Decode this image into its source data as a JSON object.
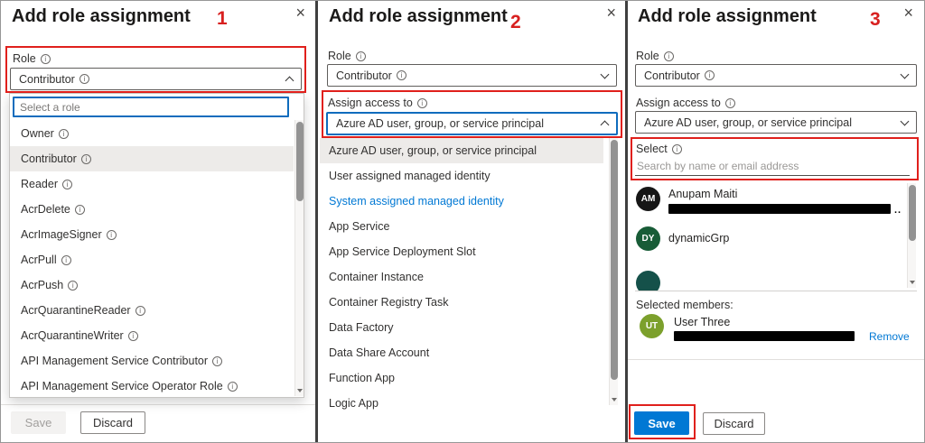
{
  "icons": {
    "close": "×",
    "info": "i"
  },
  "colors": {
    "accent": "#0078d4",
    "annotation_red": "#e0201c",
    "row_highlight": "#edebe9"
  },
  "panels": [
    {
      "title": "Add role assignment",
      "annotation": "1",
      "role": {
        "label": "Role",
        "value": "Contributor"
      },
      "role_picker": {
        "search_placeholder": "Select a role",
        "items": [
          "Owner",
          "Contributor",
          "Reader",
          "AcrDelete",
          "AcrImageSigner",
          "AcrPull",
          "AcrPush",
          "AcrQuarantineReader",
          "AcrQuarantineWriter",
          "API Management Service Contributor",
          "API Management Service Operator Role"
        ],
        "highlighted_item": "Contributor"
      },
      "footer": {
        "save": "Save",
        "discard": "Discard"
      }
    },
    {
      "title": "Add role assignment",
      "annotation": "2",
      "role": {
        "label": "Role",
        "value": "Contributor"
      },
      "assign": {
        "label": "Assign access to",
        "value": "Azure AD user, group, or service principal"
      },
      "assign_options": [
        "Azure AD user, group, or service principal",
        "User assigned managed identity",
        "System assigned managed identity",
        "App Service",
        "App Service Deployment Slot",
        "Container Instance",
        "Container Registry Task",
        "Data Factory",
        "Data Share Account",
        "Function App",
        "Logic App"
      ],
      "highlighted_option": "Azure AD user, group, or service principal",
      "link_styled_option": "System assigned managed identity"
    },
    {
      "title": "Add role assignment",
      "annotation": "3",
      "role": {
        "label": "Role",
        "value": "Contributor"
      },
      "assign": {
        "label": "Assign access to",
        "value": "Azure AD user, group, or service principal"
      },
      "select": {
        "label": "Select",
        "placeholder": "Search by name or email address"
      },
      "results": [
        {
          "initials": "AM",
          "name": "Anupam Maiti",
          "color": "#161616",
          "suffix": ".."
        },
        {
          "initials": "DY",
          "name": "dynamicGrp",
          "color": "#185c37"
        }
      ],
      "partial_avatar_color": "#15514a",
      "selected_members_label": "Selected members:",
      "selected_members": [
        {
          "initials": "UT",
          "name": "User Three",
          "color": "#7ca02c",
          "remove": "Remove"
        }
      ],
      "footer": {
        "save": "Save",
        "discard": "Discard"
      }
    }
  ]
}
